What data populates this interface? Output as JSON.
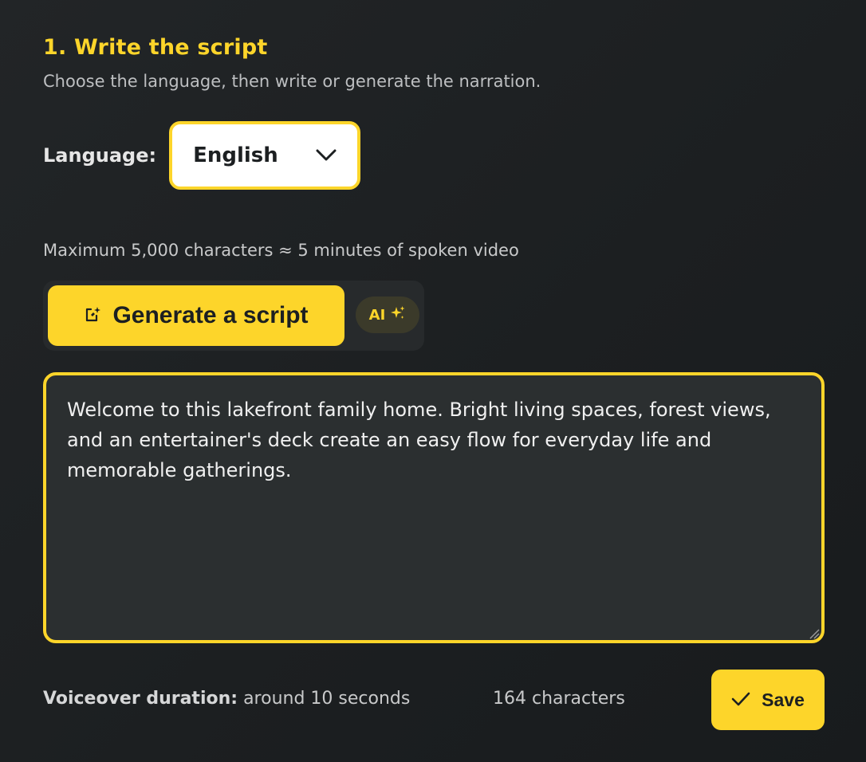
{
  "header": {
    "title": "1. Write the script",
    "subtitle": "Choose the language, then write or generate the narration."
  },
  "language": {
    "label": "Language:",
    "selected": "English"
  },
  "limit_note": "Maximum 5,000 characters ≈ 5 minutes of spoken video",
  "generate": {
    "label": "Generate a script",
    "icon": "sparkle-edit-icon",
    "ai_badge": "AI",
    "ai_icon": "sparkles-icon"
  },
  "script": {
    "text": "Welcome to this lakefront family home. Bright living spaces, forest views, and an entertainer's deck create an easy flow for everyday life and memorable gatherings."
  },
  "footer": {
    "duration_label": "Voiceover duration:",
    "duration_value": "around 10 seconds",
    "char_count": "164 characters",
    "save_label": "Save"
  },
  "colors": {
    "accent": "#fdd52a",
    "background": "#1e2123",
    "text_area": "#2b2f30"
  }
}
